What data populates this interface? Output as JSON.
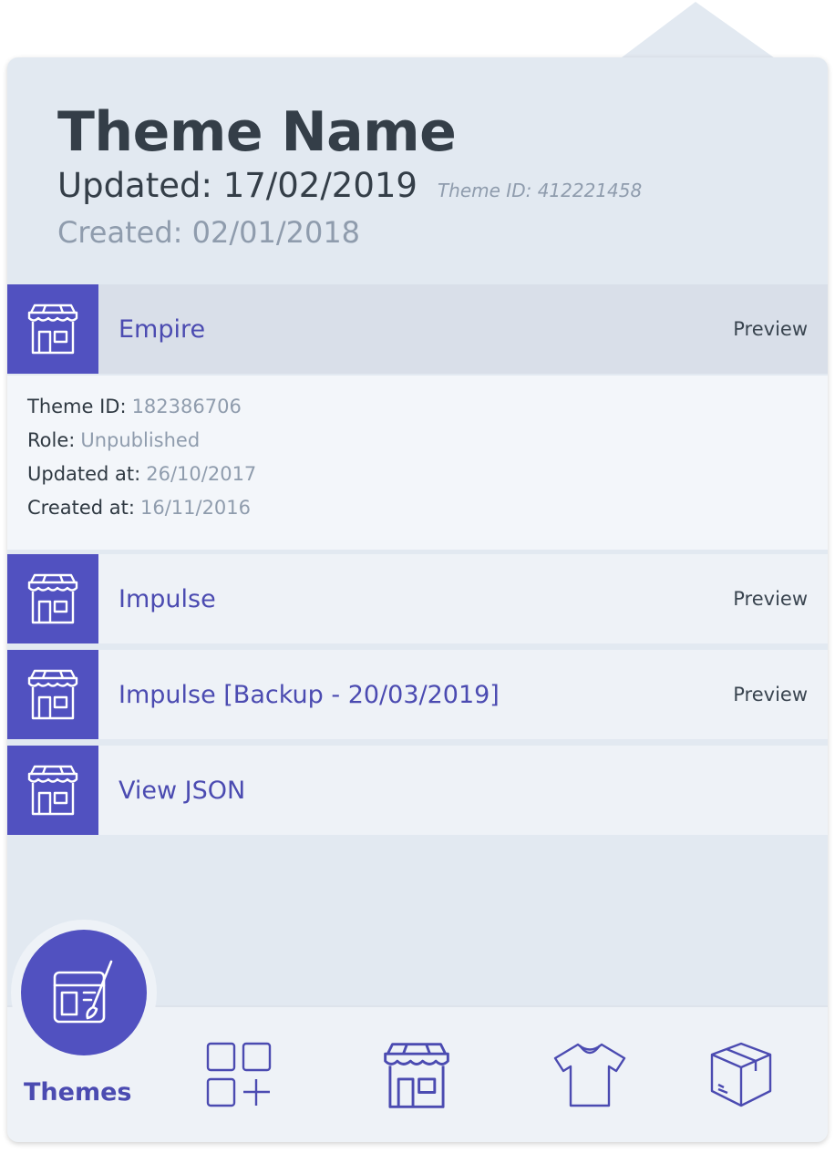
{
  "header": {
    "title": "Theme Name",
    "updated": "Updated: 17/02/2019",
    "theme_id": "Theme ID: 412221458",
    "created": "Created: 02/01/2018"
  },
  "themes": [
    {
      "name": "Empire",
      "action": "Preview",
      "details": {
        "theme_id_label": "Theme ID:",
        "theme_id": "182386706",
        "role_label": "Role:",
        "role": "Unpublished",
        "updated_label": "Updated at:",
        "updated": "26/10/2017",
        "created_label": "Created at:",
        "created": "16/11/2016"
      }
    },
    {
      "name": "Impulse",
      "action": "Preview"
    },
    {
      "name": "Impulse [Backup - 20/03/2019]",
      "action": "Preview"
    },
    {
      "name": "View JSON"
    }
  ],
  "nav": {
    "active_label": "Themes",
    "items": [
      "themes-icon",
      "add-section-icon",
      "store-icon",
      "tshirt-icon",
      "box-icon"
    ]
  },
  "colors": {
    "accent": "#5151c0",
    "accent_text": "#4b4bb1",
    "panel_bg": "#e2e9f1",
    "row_bg": "#eef2f7",
    "muted_text": "#8f9cad"
  }
}
